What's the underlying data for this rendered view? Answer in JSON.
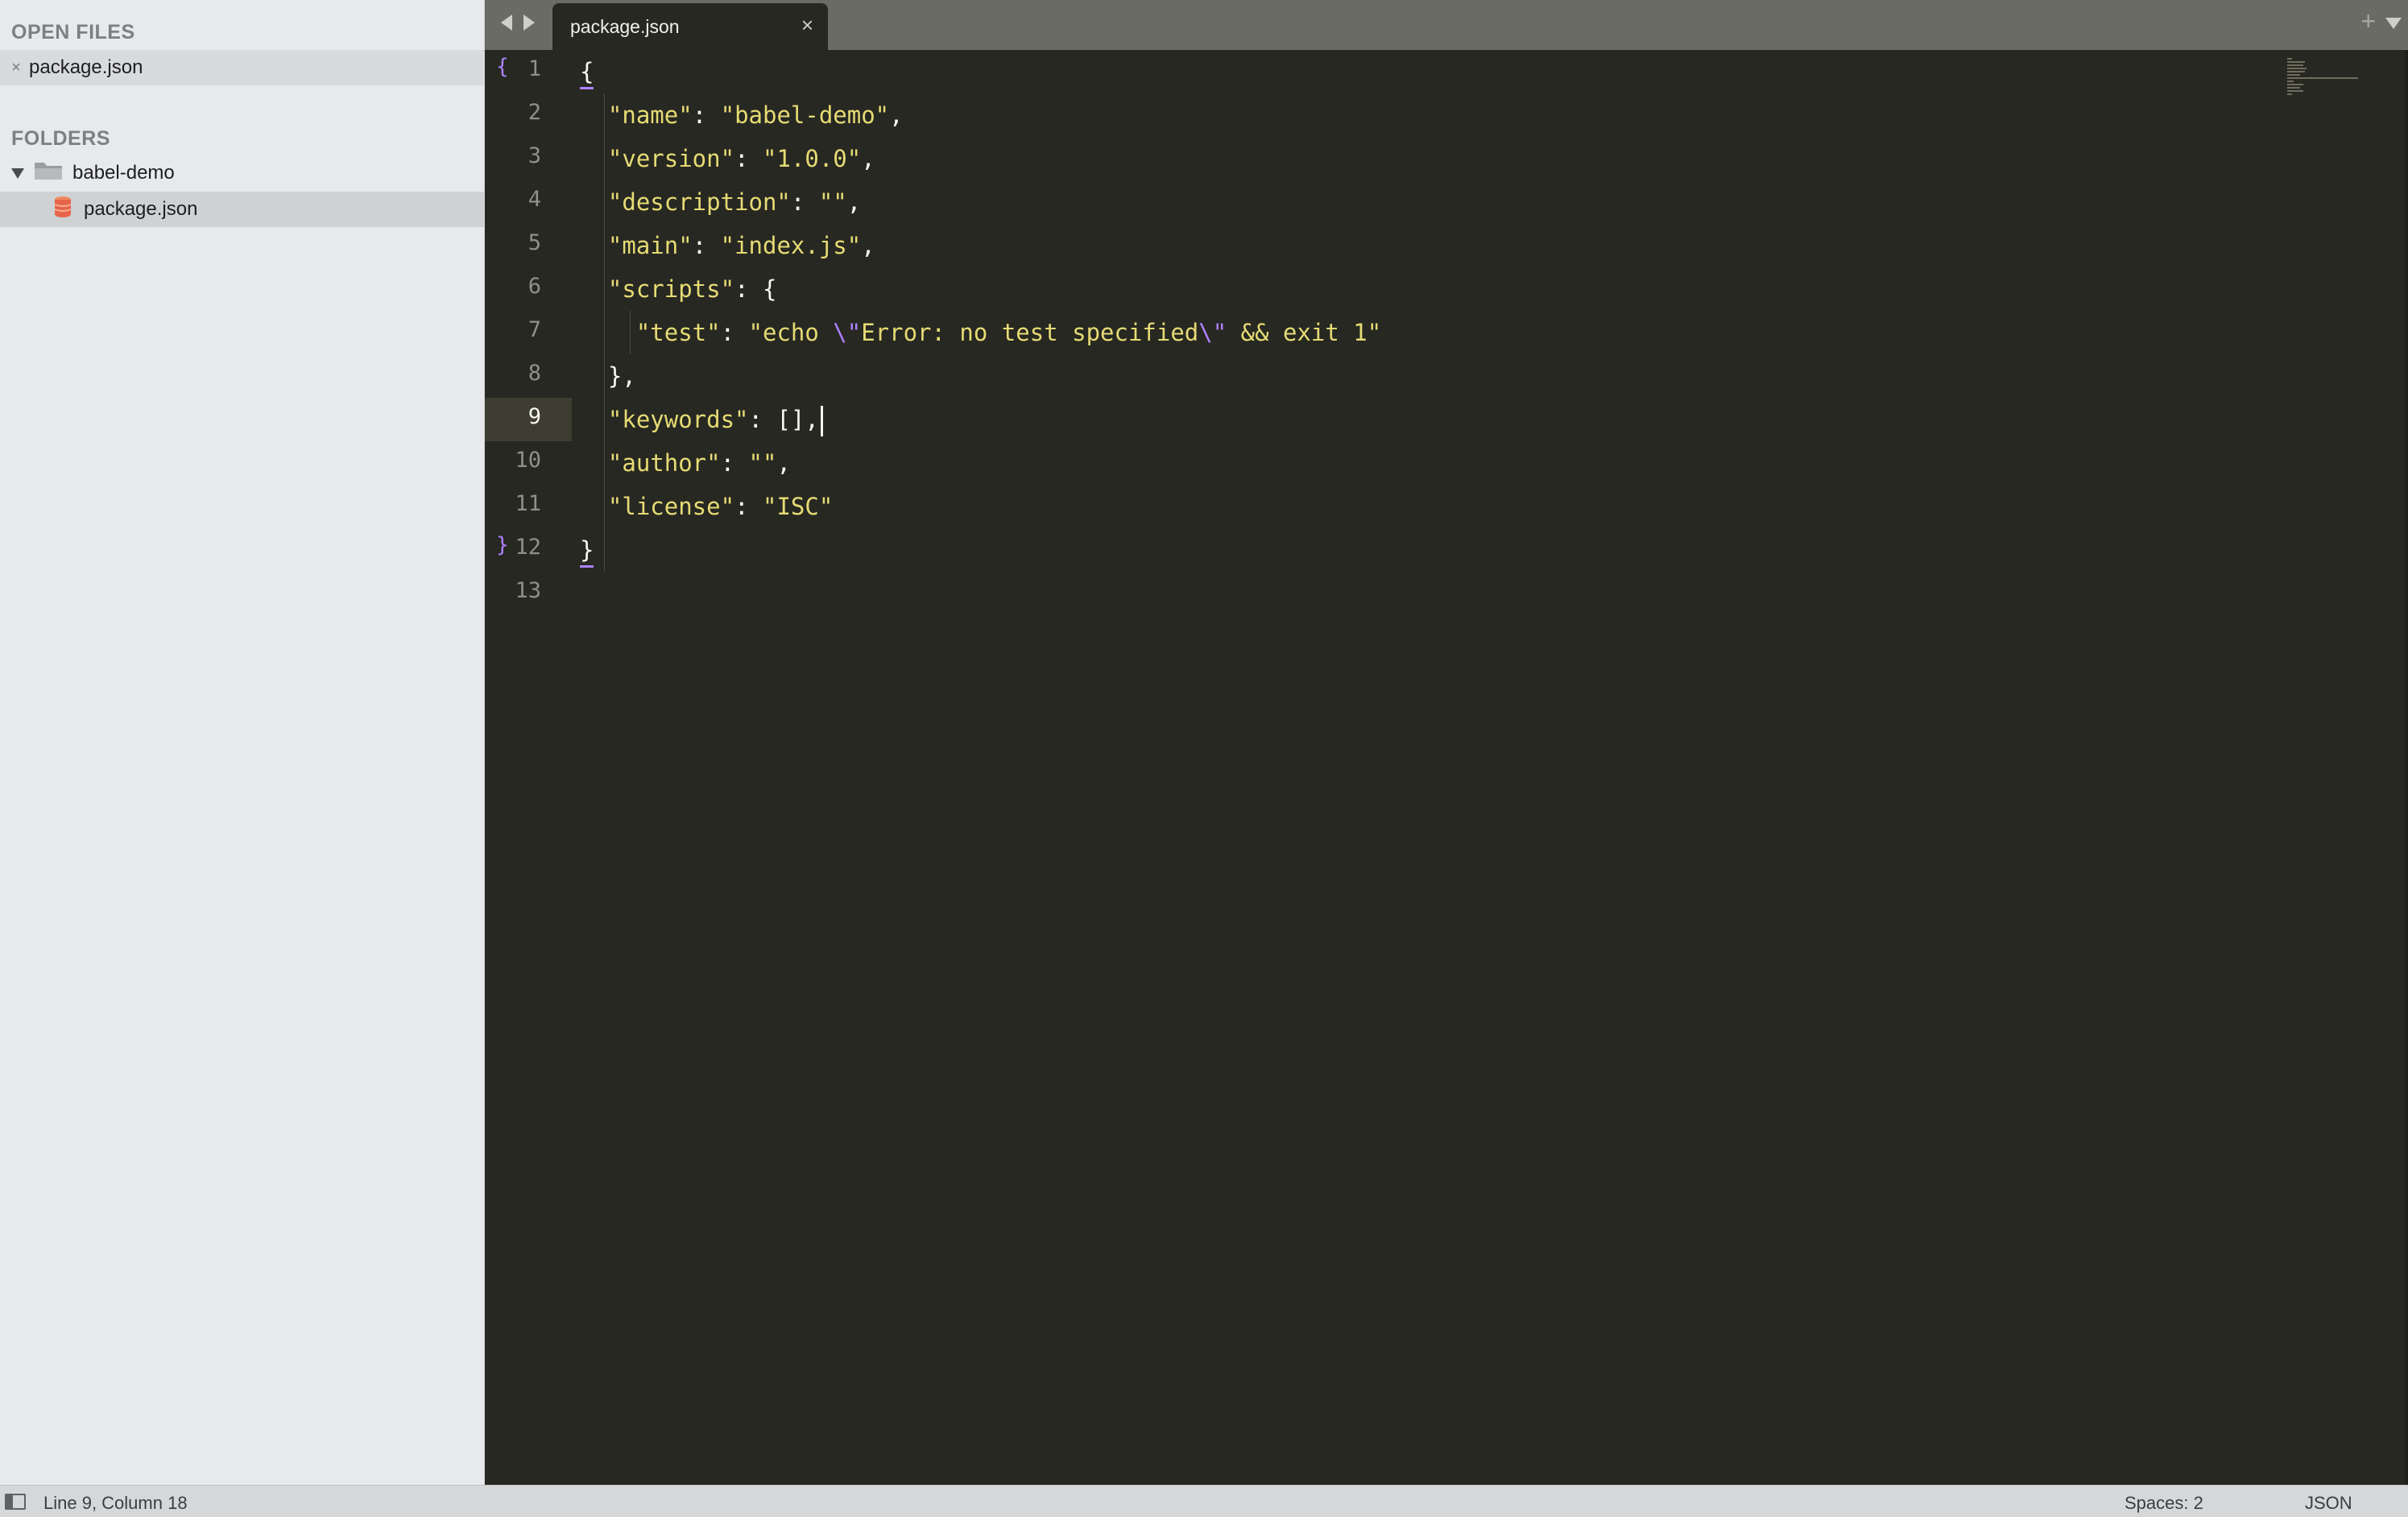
{
  "sidebar": {
    "open_files_heading": "OPEN FILES",
    "open_files": [
      {
        "name": "package.json",
        "close_glyph": "×"
      }
    ],
    "folders_heading": "FOLDERS",
    "folder": {
      "name": "babel-demo",
      "expanded": true
    },
    "folder_files": [
      {
        "name": "package.json",
        "selected": true,
        "icon": "json-file-icon"
      }
    ]
  },
  "tabs": {
    "back_icon": "nav-back-icon",
    "forward_icon": "nav-forward-icon",
    "active": {
      "label": "package.json",
      "close_glyph": "×"
    },
    "new_tab_glyph": "+",
    "menu_icon": "tab-menu-icon"
  },
  "editor": {
    "current_line": 9,
    "line_numbers": [
      "1",
      "2",
      "3",
      "4",
      "5",
      "6",
      "7",
      "8",
      "9",
      "10",
      "11",
      "12",
      "13"
    ],
    "fold_marks": {
      "open": "{",
      "close": "}"
    },
    "colors": {
      "background": "#272822",
      "string": "#e6db74",
      "escape": "#ae81ff",
      "punctuation": "#f8f8f2",
      "line_number": "#90908a"
    },
    "lines": {
      "l1": {
        "brace": "{"
      },
      "l2": {
        "key": "\"name\"",
        "sep": ": ",
        "val": "\"babel-demo\"",
        "end": ","
      },
      "l3": {
        "key": "\"version\"",
        "sep": ": ",
        "val": "\"1.0.0\"",
        "end": ","
      },
      "l4": {
        "key": "\"description\"",
        "sep": ": ",
        "val": "\"\"",
        "end": ","
      },
      "l5": {
        "key": "\"main\"",
        "sep": ": ",
        "val": "\"index.js\"",
        "end": ","
      },
      "l6": {
        "key": "\"scripts\"",
        "sep": ": ",
        "end": "{"
      },
      "l7": {
        "key": "\"test\"",
        "sep": ": ",
        "val_a": "\"echo ",
        "esc_a": "\\\"",
        "val_b": "Error: no test specified",
        "esc_b": "\\\"",
        "val_c": " && exit 1\""
      },
      "l8": {
        "text": "},"
      },
      "l9": {
        "key": "\"keywords\"",
        "sep": ": ",
        "end": "[],"
      },
      "l10": {
        "key": "\"author\"",
        "sep": ": ",
        "val": "\"\"",
        "end": ","
      },
      "l11": {
        "key": "\"license\"",
        "sep": ": ",
        "val": "\"ISC\""
      },
      "l12": {
        "brace": "}"
      }
    }
  },
  "statusbar": {
    "position": "Line 9, Column 18",
    "indentation": "Spaces: 2",
    "syntax": "JSON"
  }
}
